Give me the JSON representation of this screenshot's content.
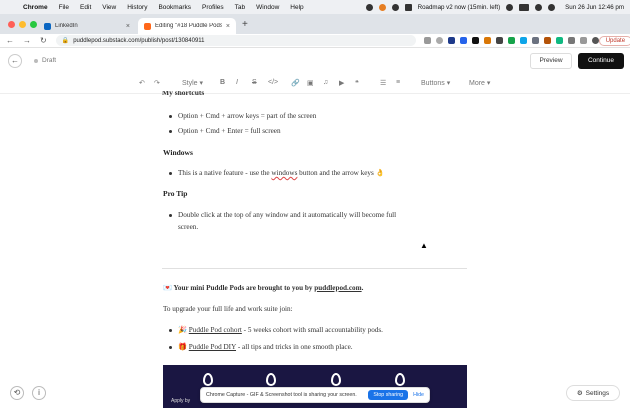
{
  "menubar": {
    "app": "Chrome",
    "items": [
      "File",
      "Edit",
      "View",
      "History",
      "Bookmarks",
      "Profiles",
      "Tab",
      "Window",
      "Help"
    ],
    "timer": "Roadmap v2 now (15min. left)",
    "clock": "Sun 26 Jun  12:46 pm"
  },
  "tabs": [
    {
      "title": "LinkedIn",
      "favicon_color": "#0a66c2"
    },
    {
      "title": "Editing \"#18 Puddle Pods - Lo...",
      "favicon_color": "#ff6719"
    }
  ],
  "address": {
    "url": "puddlepod.substack.com/publish/post/130840911",
    "update_label": "Update"
  },
  "header": {
    "status": "Draft",
    "preview_label": "Preview",
    "continue_label": "Continue"
  },
  "toolbar": {
    "style_label": "Style",
    "buttons_label": "Buttons",
    "more_label": "More"
  },
  "content": {
    "cut_heading": "My shortcuts",
    "mac_items": [
      "Option + Cmd + arrow keys = part of the screen",
      "Option + Cmd + Enter = full screen"
    ],
    "windows_heading": "Windows",
    "windows_item_pre": "This is a native feature - use the ",
    "windows_item_link": "windows",
    "windows_item_post": " button and the arrow keys 👌",
    "protip_heading": "Pro Tip",
    "protip_line1": "Double click at the top of any window and it automatically will become full",
    "protip_line2": "screen.",
    "promo_pre": "💌 Your mini Puddle Pods are brought to you by ",
    "promo_link": "puddlepod.com",
    "promo_post": ".",
    "upgrade_line": "To upgrade your full life and work suite join:",
    "cohort_link": "Puddle Pod cohort",
    "cohort_rest": " - 5 weeks cohort with small accountability pods.",
    "diy_link": "Puddle Pod DIY",
    "diy_rest": " - all tips and tricks in one smooth place.",
    "image_caption": "Apply by"
  },
  "sharebar": {
    "text": "Chrome Capture - GIF & Screenshot tool is sharing your screen.",
    "stop_label": "Stop sharing",
    "hide_label": "Hide"
  },
  "settings_label": "Settings"
}
